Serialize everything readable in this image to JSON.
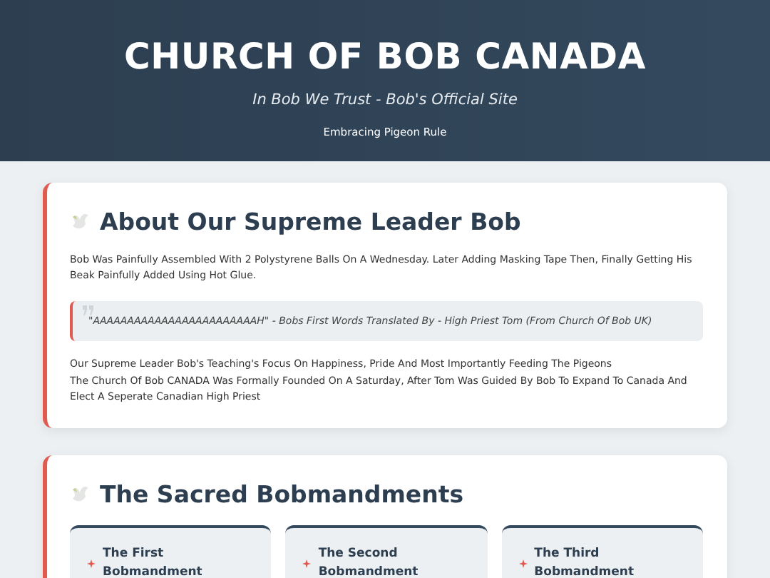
{
  "header": {
    "title": "CHURCH OF BOB CANADA",
    "subtitle": "In Bob We Trust - Bob's Official Site",
    "tagline": "Embracing Pigeon Rule"
  },
  "about": {
    "heading": "About Our Supreme Leader Bob",
    "intro": "Bob Was Painfully Assembled With 2 Polystyrene Balls On A Wednesday. Later Adding Masking Tape Then, Finally Getting His Beak Painfully Added Using Hot Glue.",
    "quote": "\"AAAAAAAAAAAAAAAAAAAAAAAAH\" - Bobs First Words Translated By - High Priest Tom (From Church Of Bob UK)",
    "paragraphs": [
      "Our Supreme Leader Bob's Teaching's Focus On Happiness, Pride And Most Importantly Feeding The Pigeons",
      "The Church Of Bob CANADA Was Formally Founded On A Saturday, After Tom Was Guided By Bob To Expand To Canada And Elect A Seperate Canadian High Priest"
    ]
  },
  "bobmandments": {
    "heading": "The Sacred Bobmandments",
    "cards": [
      {
        "title": "The First Bobmandment"
      },
      {
        "title": "The Second Bobmandment"
      },
      {
        "title": "The Third Bobmandment"
      }
    ]
  }
}
